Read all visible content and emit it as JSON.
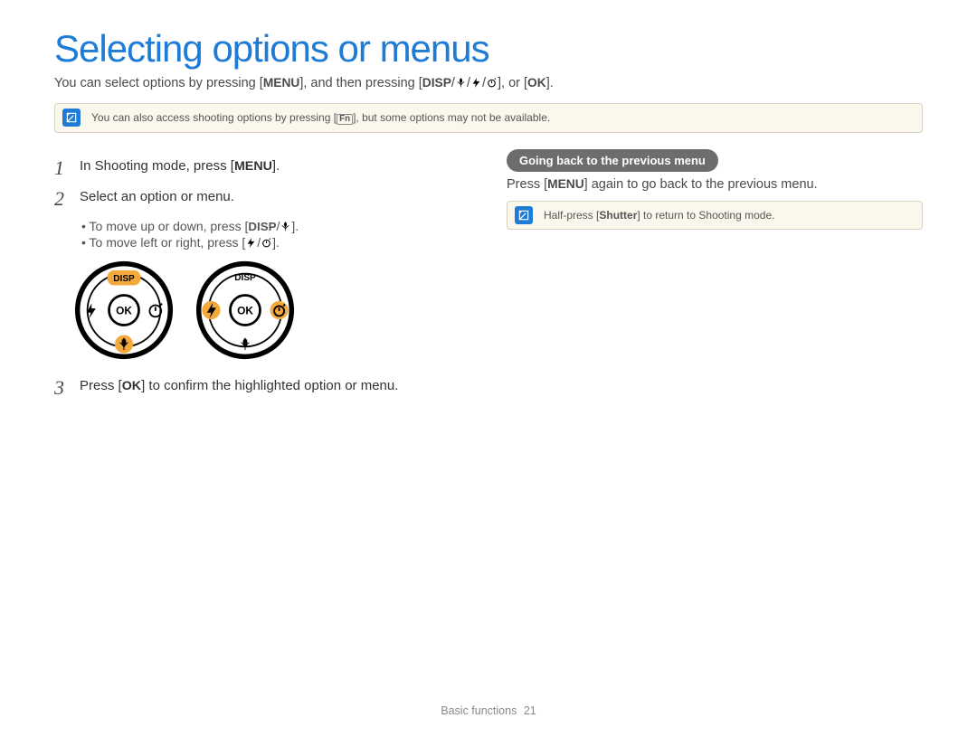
{
  "title": "Selecting options or menus",
  "intro": {
    "pre": "You can select options by pressing [",
    "menu": "MENU",
    "mid": "], and then pressing [",
    "disp": "DISP",
    "sep1": "/",
    "macro": "macro",
    "sep2": "/",
    "flash": "flash",
    "sep3": "/",
    "timer": "timer",
    "mid2": "], or [",
    "ok": "OK",
    "end": "]."
  },
  "note1": {
    "pre": "You can also access shooting options by pressing [",
    "fn": "Fn",
    "post": "], but some options may not be available."
  },
  "steps": {
    "s1": {
      "num": "1",
      "pre": "In Shooting mode, press [",
      "menu": "MENU",
      "post": "]."
    },
    "s2": {
      "num": "2",
      "text": "Select an option or menu."
    },
    "s2sub": {
      "a_pre": "To move up or down, press [",
      "a_disp": "DISP",
      "a_sep": "/",
      "a_macro": "macro",
      "a_post": "].",
      "b_pre": "To move left or right, press [",
      "b_flash": "flash",
      "b_sep": "/",
      "b_timer": "timer",
      "b_post": "]."
    },
    "s3": {
      "num": "3",
      "pre": "Press [",
      "ok": "OK",
      "post": "] to confirm the highlighted option or menu."
    }
  },
  "right": {
    "heading": "Going back to the previous menu",
    "text_pre": "Press [",
    "menu": "MENU",
    "text_post": "] again to go back to the previous menu.",
    "note_pre": "Half-press [",
    "note_key": "Shutter",
    "note_post": "] to return to Shooting mode."
  },
  "dial": {
    "disp": "DISP",
    "ok": "OK"
  },
  "footer": {
    "section": "Basic functions",
    "page": "21"
  }
}
